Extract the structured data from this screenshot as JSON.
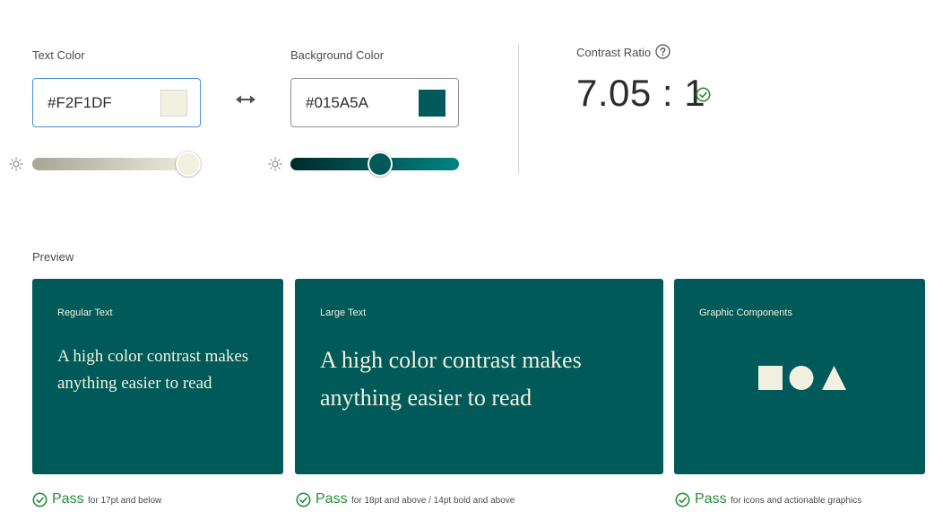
{
  "text_color": {
    "label": "Text Color",
    "value": "#F2F1DF",
    "swatch": "#f2f1df",
    "slider_gradient": [
      "#a6a596",
      "#f2f1df"
    ],
    "brightness_level": 1.0,
    "icon": "brightness-icon"
  },
  "swap": {
    "icon": "swap-arrows-icon"
  },
  "background_color": {
    "label": "Background Color",
    "value": "#015A5A",
    "swatch": "#015a5a",
    "slider_gradient": [
      "#002a2a",
      "#008383"
    ],
    "brightness_level": 0.54,
    "icon": "brightness-icon"
  },
  "contrast": {
    "label": "Contrast Ratio",
    "value": "7.05 : 1",
    "help_icon": "question-circle-icon",
    "status_icon": "check-circle-icon",
    "status_color": "#268e3b"
  },
  "preview": {
    "label": "Preview",
    "background": "#015a5a",
    "foreground": "#f2f1df",
    "cards": [
      {
        "label": "Regular Text",
        "sample": "A high color contrast makes anything easier to read",
        "result": "Pass",
        "note": "for 17pt and below"
      },
      {
        "label": "Large Text",
        "sample": "A high color contrast makes anything easier to read",
        "result": "Pass",
        "note": "for 18pt and above / 14pt bold and above"
      },
      {
        "label": "Graphic Components",
        "shapes": [
          "square",
          "circle",
          "triangle"
        ],
        "result": "Pass",
        "note": "for icons and actionable graphics"
      }
    ]
  }
}
